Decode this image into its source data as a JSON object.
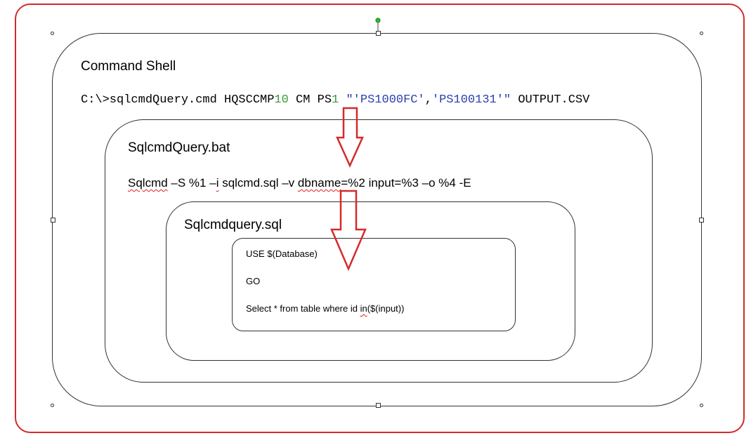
{
  "colors": {
    "frame": "#d42a2a",
    "arrow": "#d42a2a",
    "number_green": "#3a9a3a",
    "string_blue": "#2a3fb0",
    "rotate_handle": "#2db52d"
  },
  "command_shell": {
    "title": "Command Shell",
    "cmd_part1": "C:\\>sqlcmdQuery.cmd HQSCCMP",
    "cmd_num1": "10",
    "cmd_part2": " CM PS",
    "cmd_num2": "1",
    "cmd_str1": " \"'PS1000FC'",
    "cmd_sep": ",",
    "cmd_str2": "'PS100131'\"",
    "cmd_part3": " OUTPUT.CSV"
  },
  "bat_file": {
    "title": "SqlcmdQuery.bat",
    "cmd_sqlcmd": "Sqlcmd",
    "cmd_mid1": " –S %1 –",
    "cmd_i": "i",
    "cmd_mid2": " sqlcmd.sql –v ",
    "cmd_dbname": "dbname",
    "cmd_rest": "=%2 input=%3 –o %4 -E"
  },
  "sql_file": {
    "title": "Sqlcmdquery.sql",
    "line1": "USE $(Database)",
    "line2": "GO",
    "line3_pre": "Select * from table where id ",
    "line3_in": "in",
    "line3_post": "($(input))"
  },
  "icons": [
    "down-arrow-icon",
    "down-arrow-icon",
    "rotate-handle-icon",
    "resize-handle-icon"
  ]
}
